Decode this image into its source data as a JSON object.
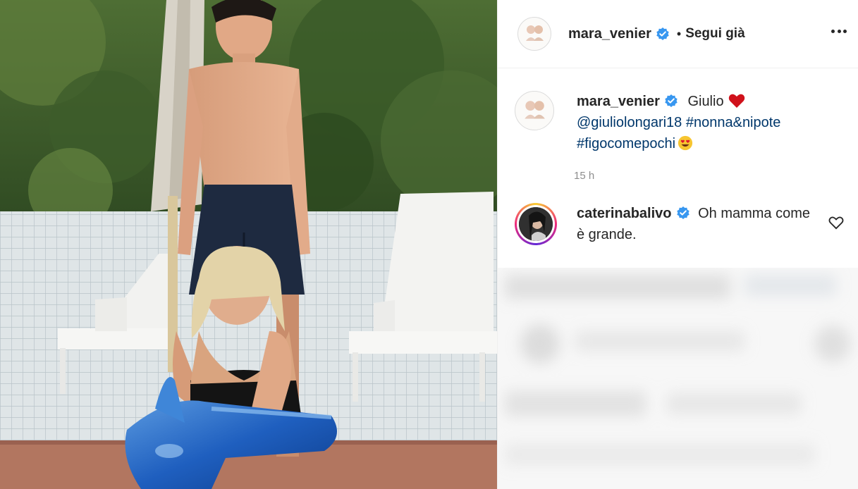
{
  "post": {
    "author": "mara_venier",
    "follow_status": "Segui già",
    "separator": "•",
    "more_icon": "more-horizontal-icon",
    "verified_color": "#3897f0",
    "caption": {
      "username": "mara_venier",
      "text": "Giulio",
      "mention": "@giuliolongari18",
      "hashtag1": "#nonna&nipote",
      "hashtag2": "#figocomepochi",
      "emoji1": "red-heart",
      "emoji2": "heart-eyes"
    },
    "timestamp": "15 h",
    "comments": [
      {
        "username": "caterinabalivo",
        "text": "Oh mamma come è grande.",
        "like_icon": "heart-outline-icon"
      }
    ]
  }
}
